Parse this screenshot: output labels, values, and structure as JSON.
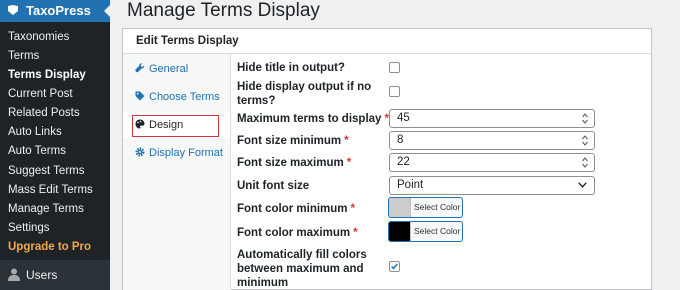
{
  "sidebar": {
    "plugin_name": "TaxoPress",
    "items": [
      {
        "label": "Taxonomies"
      },
      {
        "label": "Terms"
      },
      {
        "label": "Terms Display"
      },
      {
        "label": "Current Post"
      },
      {
        "label": "Related Posts"
      },
      {
        "label": "Auto Links"
      },
      {
        "label": "Auto Terms"
      },
      {
        "label": "Suggest Terms"
      },
      {
        "label": "Mass Edit Terms"
      },
      {
        "label": "Manage Terms"
      },
      {
        "label": "Settings"
      },
      {
        "label": "Upgrade to Pro"
      }
    ],
    "users_label": "Users"
  },
  "page_title": "Manage Terms Display",
  "card_title": "Edit Terms Display",
  "tabs": [
    {
      "label": "General",
      "icon": "wrench-icon"
    },
    {
      "label": "Choose Terms",
      "icon": "tag-icon"
    },
    {
      "label": "Design",
      "icon": "palette-icon"
    },
    {
      "label": "Display Format",
      "icon": "gear-icon"
    }
  ],
  "form": {
    "hide_title": {
      "label": "Hide title in output?",
      "checked": false
    },
    "hide_display": {
      "label_line1": "Hide display output if no",
      "label_line2": "terms?",
      "checked": false
    },
    "max_terms": {
      "label": "Maximum terms to display",
      "required_mark": "*",
      "value": "45"
    },
    "font_min": {
      "label": "Font size minimum",
      "required_mark": "*",
      "value": "8"
    },
    "font_max": {
      "label": "Font size maximum",
      "required_mark": "*",
      "value": "22"
    },
    "unit_font": {
      "label": "Unit font size",
      "value": "Point"
    },
    "color_min": {
      "label": "Font color minimum",
      "required_mark": "*",
      "button": "Select Color",
      "swatch": "#cccccc"
    },
    "color_max": {
      "label": "Font color maximum",
      "required_mark": "*",
      "button": "Select Color",
      "swatch": "#000000"
    },
    "auto_fill": {
      "label_line1": "Automatically fill colors",
      "label_line2": "between maximum and",
      "label_line3": "minimum",
      "checked": true
    }
  },
  "colors": {
    "accent": "#2271b1",
    "sidebar": "#1d2327",
    "required": "#d63638",
    "pro": "#f6a84a"
  }
}
